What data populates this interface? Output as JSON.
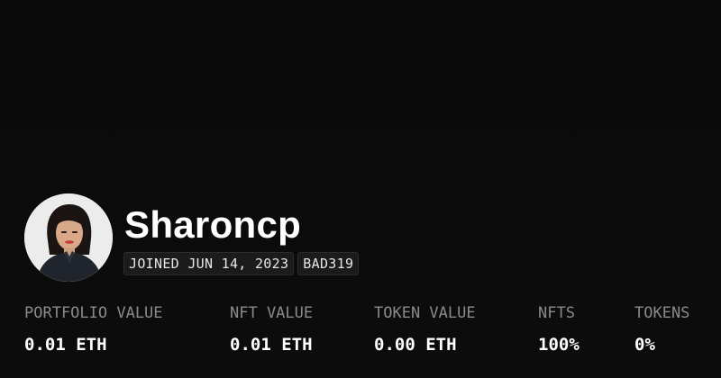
{
  "profile": {
    "username": "Sharoncp",
    "avatar_icon": "user-avatar-photo",
    "joined": "JOINED JUN 14, 2023",
    "tag": "BAD319"
  },
  "stats": {
    "portfolio": {
      "label": "PORTFOLIO VALUE",
      "value": "0.01 ETH"
    },
    "nft": {
      "label": "NFT VALUE",
      "value": "0.01 ETH"
    },
    "token": {
      "label": "TOKEN VALUE",
      "value": "0.00 ETH"
    },
    "nfts": {
      "label": "NFTS",
      "value": "100%"
    },
    "tokens": {
      "label": "TOKENS",
      "value": "0%"
    }
  },
  "colors": {
    "background": "#0a0a0a",
    "text_primary": "#ffffff",
    "text_muted": "#8a8a8a",
    "badge_bg": "#1b1b1b"
  }
}
